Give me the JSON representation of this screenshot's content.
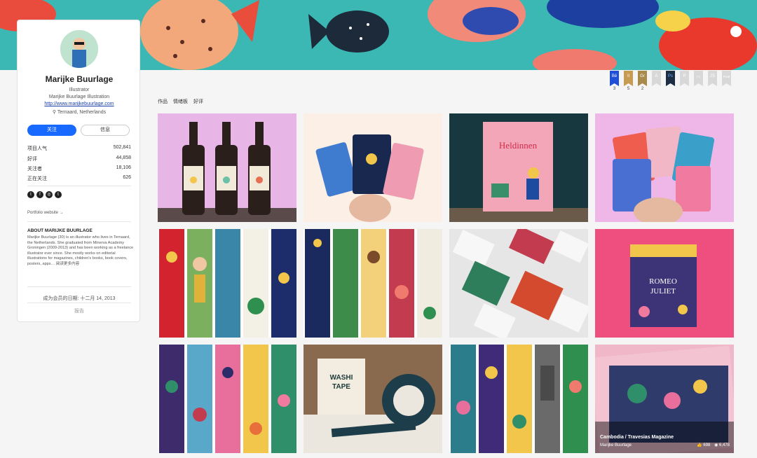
{
  "profile": {
    "name": "Marijke Buurlage",
    "role": "Illustrator",
    "company": "Marijke Buurlage Illustration",
    "website": "http://www.marijkebuurlage.com",
    "location": "Ternaard, Netherlands",
    "follow_label": "关注",
    "message_label": "信息"
  },
  "stats": [
    {
      "label": "项目人气",
      "value": "502,841"
    },
    {
      "label": "好评",
      "value": "44,858"
    },
    {
      "label": "关注者",
      "value": "18,106"
    },
    {
      "label": "正在关注",
      "value": "626"
    }
  ],
  "socials": [
    "twitter-icon",
    "facebook-icon",
    "instagram-icon",
    "tumblr-icon"
  ],
  "portfolio_link": "Portfolio website →",
  "about": {
    "heading": "ABOUT MARIJKE BUURLAGE",
    "text": "Marijke Buurlage (30) is an illustrator who lives in Ternaard, the Netherlands. She graduated from Minerva Academy Groningen (2009-2013) and has been working as a freelance illustrator ever since. She mostly works on editorial illustrations for magazines, children's books, book covers, posters, apps… 阅读更多内容"
  },
  "member_since": "成为会员的日期: 十二月 14, 2013",
  "report_label": "报告",
  "tools": [
    {
      "name": "Bē",
      "count": "3",
      "color": "#1e4fd6"
    },
    {
      "name": "Il",
      "count": "5",
      "color": "#c79b52"
    },
    {
      "name": "Gr",
      "count": "2",
      "color": "#a98a4b"
    },
    {
      "name": "A",
      "count": "",
      "color": "#d8d8d8"
    },
    {
      "name": "Ps",
      "count": "",
      "color": "#1c2d44"
    },
    {
      "name": "P",
      "count": "",
      "color": "#d8d8d8"
    },
    {
      "name": "▭",
      "count": "",
      "color": "#d8d8d8"
    },
    {
      "name": "25",
      "count": "",
      "color": "#d8d8d8"
    },
    {
      "name": "Pratt",
      "count": "",
      "color": "#d8d8d8"
    }
  ],
  "tabs": [
    "作品",
    "情绪板",
    "好评"
  ],
  "hover_project": {
    "title": "Cambodia / Travesias Magazine",
    "owner": "Marijke Buurlage",
    "likes": "698",
    "views": "6,478"
  },
  "colors": {
    "accent": "#1769ff",
    "banner": "#3bb7b4"
  }
}
